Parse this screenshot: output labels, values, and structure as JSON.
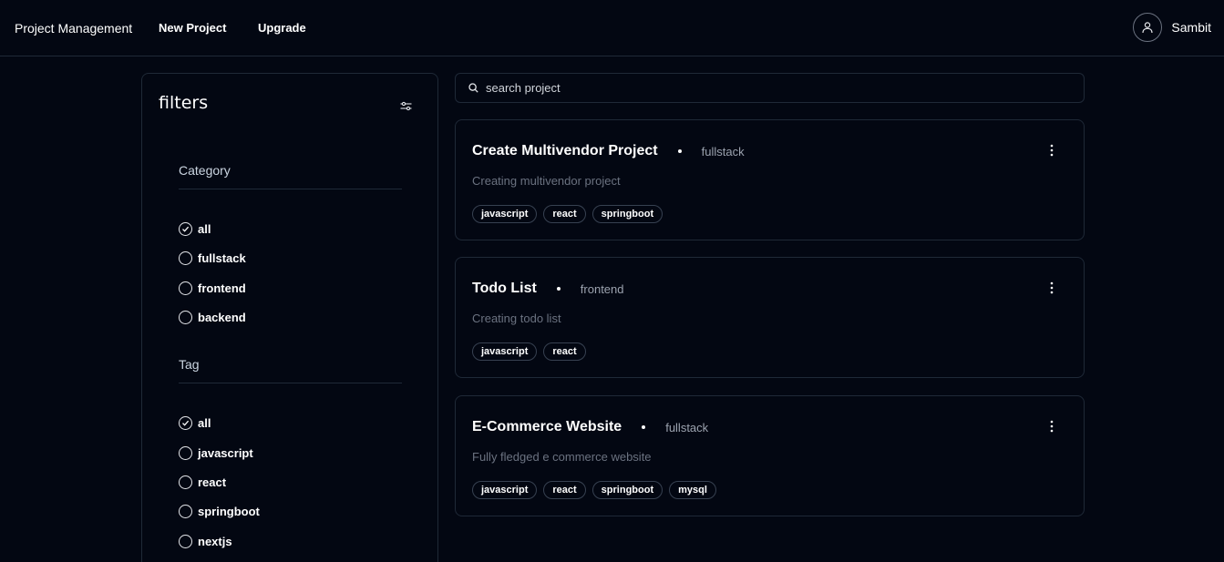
{
  "nav": {
    "brand": "Project Management",
    "new_project": "New Project",
    "upgrade": "Upgrade",
    "user_name": "Sambit"
  },
  "filters": {
    "title": "filters",
    "category": {
      "label": "Category",
      "options": [
        "all",
        "fullstack",
        "frontend",
        "backend"
      ],
      "selected": "all"
    },
    "tag": {
      "label": "Tag",
      "options": [
        "all",
        "javascript",
        "react",
        "springboot",
        "nextjs"
      ],
      "selected": "all"
    }
  },
  "search": {
    "placeholder": "search project",
    "value": ""
  },
  "projects": [
    {
      "title": "Create Multivendor Project",
      "category": "fullstack",
      "description": "Creating multivendor project",
      "tags": [
        "javascript",
        "react",
        "springboot"
      ]
    },
    {
      "title": "Todo List",
      "category": "frontend",
      "description": "Creating todo list",
      "tags": [
        "javascript",
        "react"
      ]
    },
    {
      "title": "E-Commerce Website",
      "category": "fullstack",
      "description": "Fully fledged e commerce website",
      "tags": [
        "javascript",
        "react",
        "springboot",
        "mysql"
      ]
    }
  ],
  "colors": {
    "background": "#030712",
    "border": "#1f2937",
    "muted_text": "#9ca3af"
  }
}
